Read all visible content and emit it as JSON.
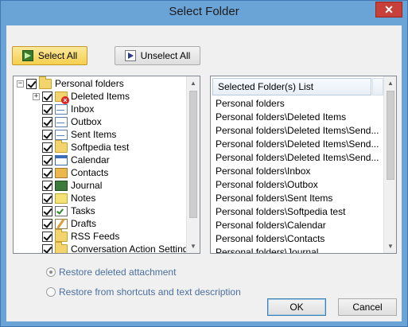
{
  "window": {
    "title": "Select Folder",
    "close_glyph": "✕",
    "frame_color": "#6aa3d6"
  },
  "toolbar": {
    "select_all_label": "Select All",
    "unselect_all_label": "Unselect All",
    "select_all_icon": "select-all-icon",
    "unselect_all_icon": "unselect-all-icon"
  },
  "tree": {
    "expand_glyph": "+",
    "collapse_glyph": "−",
    "items": [
      {
        "label": "Personal folders",
        "icon": "folder",
        "checked": true,
        "expanded": true
      },
      {
        "label": "Deleted Items",
        "icon": "deleted",
        "checked": true,
        "expanded": false
      },
      {
        "label": "Inbox",
        "icon": "mail",
        "checked": true
      },
      {
        "label": "Outbox",
        "icon": "mail",
        "checked": true
      },
      {
        "label": "Sent Items",
        "icon": "mail",
        "checked": true
      },
      {
        "label": "Softpedia test",
        "icon": "folder",
        "checked": true
      },
      {
        "label": "Calendar",
        "icon": "calendar",
        "checked": true
      },
      {
        "label": "Contacts",
        "icon": "contacts",
        "checked": true
      },
      {
        "label": "Journal",
        "icon": "journal",
        "checked": true
      },
      {
        "label": "Notes",
        "icon": "notes",
        "checked": true
      },
      {
        "label": "Tasks",
        "icon": "tasks",
        "checked": true
      },
      {
        "label": "Drafts",
        "icon": "drafts",
        "checked": true
      },
      {
        "label": "RSS Feeds",
        "icon": "folder",
        "checked": true
      },
      {
        "label": "Conversation Action Settings",
        "icon": "folder",
        "checked": true
      }
    ]
  },
  "selected_list": {
    "header": "Selected Folder(s) List",
    "items": [
      "Personal folders",
      "Personal folders\\Deleted Items",
      "Personal folders\\Deleted Items\\Send...",
      "Personal folders\\Deleted Items\\Send...",
      "Personal folders\\Deleted Items\\Send...",
      "Personal folders\\Inbox",
      "Personal folders\\Outbox",
      "Personal folders\\Sent Items",
      "Personal folders\\Softpedia test",
      "Personal folders\\Calendar",
      "Personal folders\\Contacts",
      "Personal folders\\Journal"
    ]
  },
  "options": {
    "restore_deleted_label": "Restore deleted attachment",
    "restore_deleted_selected": true,
    "restore_shortcuts_label": "Restore from shortcuts and text description",
    "restore_shortcuts_selected": false
  },
  "footer": {
    "ok_label": "OK",
    "cancel_label": "Cancel"
  },
  "scroll": {
    "up_glyph": "▲",
    "down_glyph": "▼"
  }
}
